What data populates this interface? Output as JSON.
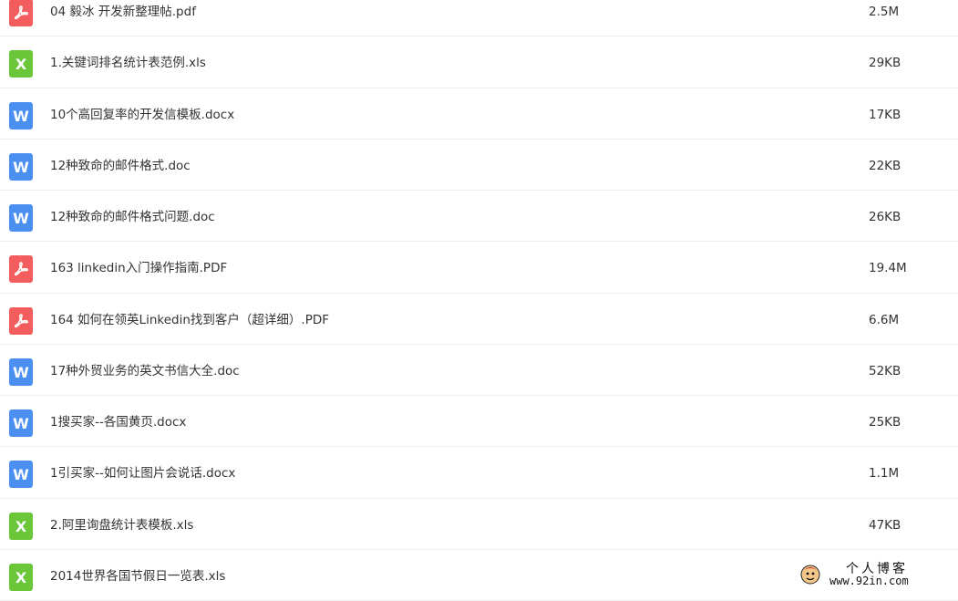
{
  "colors": {
    "pdf": "#f35d5d",
    "xls": "#6bc63a",
    "doc": "#4b8ff0"
  },
  "icons": {
    "pdf": "pdf-icon",
    "xls": "excel-icon",
    "doc": "word-icon"
  },
  "files": [
    {
      "name": "04 毅冰 开发新整理帖.pdf",
      "size": "2.5M",
      "type": "pdf"
    },
    {
      "name": "1.关键词排名统计表范例.xls",
      "size": "29KB",
      "type": "xls"
    },
    {
      "name": "10个高回复率的开发信模板.docx",
      "size": "17KB",
      "type": "doc"
    },
    {
      "name": "12种致命的邮件格式.doc",
      "size": "22KB",
      "type": "doc"
    },
    {
      "name": "12种致命的邮件格式问题.doc",
      "size": "26KB",
      "type": "doc"
    },
    {
      "name": "163 linkedin入门操作指南.PDF",
      "size": "19.4M",
      "type": "pdf"
    },
    {
      "name": "164 如何在领英Linkedin找到客户（超详细）.PDF",
      "size": "6.6M",
      "type": "pdf"
    },
    {
      "name": "17种外贸业务的英文书信大全.doc",
      "size": "52KB",
      "type": "doc"
    },
    {
      "name": "1搜买家--各国黄页.docx",
      "size": "25KB",
      "type": "doc"
    },
    {
      "name": "1引买家--如何让图片会说话.docx",
      "size": "1.1M",
      "type": "doc"
    },
    {
      "name": "2.阿里询盘统计表模板.xls",
      "size": "47KB",
      "type": "xls"
    },
    {
      "name": "2014世界各国节假日一览表.xls",
      "size": "",
      "type": "xls"
    }
  ],
  "watermark": {
    "title": "个人博客",
    "url": "www.92in.com"
  }
}
